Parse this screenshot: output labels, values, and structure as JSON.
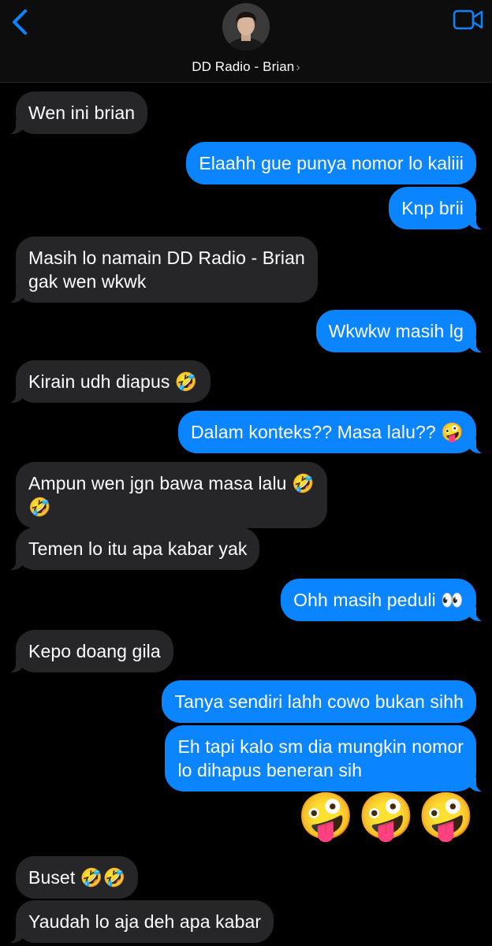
{
  "header": {
    "contact_name": "DD Radio - Brian",
    "chevron": "›",
    "back_icon": "chevron-left-icon",
    "video_icon": "video-camera-icon",
    "accent_color": "#0a84ff"
  },
  "messages": [
    {
      "side": "in",
      "text": "Wen ini brian"
    },
    {
      "side": "out",
      "text": "Elaahh gue punya nomor lo kaliii"
    },
    {
      "side": "out",
      "text": "Knp brii"
    },
    {
      "side": "in",
      "text": "Masih lo namain DD Radio - Brian\ngak wen wkwk"
    },
    {
      "side": "out",
      "text": "Wkwkw masih lg"
    },
    {
      "side": "in",
      "text": "Kirain udh diapus 🤣"
    },
    {
      "side": "out",
      "text": "Dalam konteks?? Masa lalu?? 🤪"
    },
    {
      "side": "in",
      "text": "Ampun wen jgn bawa masa lalu 🤣\n🤣"
    },
    {
      "side": "in",
      "text": "Temen lo itu apa kabar yak"
    },
    {
      "side": "out",
      "text": "Ohh masih peduli 👀"
    },
    {
      "side": "in",
      "text": "Kepo doang gila"
    },
    {
      "side": "out",
      "text": "Tanya sendiri lahh cowo bukan sihh"
    },
    {
      "side": "out",
      "text": "Eh tapi kalo sm dia mungkin nomor\nlo dihapus beneran sih"
    },
    {
      "side": "out-emoji",
      "text": "🤪🤪🤪"
    },
    {
      "side": "in",
      "text": "Buset 🤣🤣"
    },
    {
      "side": "in",
      "text": "Yaudah lo aja deh apa kabar"
    }
  ]
}
